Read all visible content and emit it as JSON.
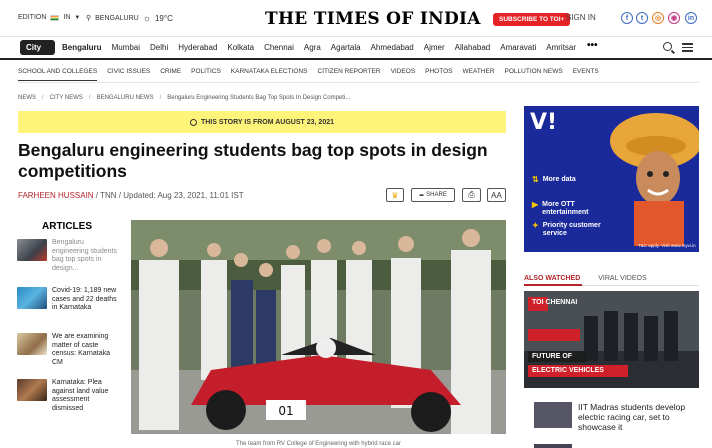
{
  "header": {
    "edition_label": "EDITION",
    "edition_value": "IN",
    "city": "BENGALURU",
    "temperature": "19°C",
    "logo": "THE TIMES OF INDIA",
    "subscribe": "SUBSCRIBE TO TOI+",
    "signin": "SIGN IN",
    "social": [
      "f",
      "t",
      "◎",
      "◉",
      "in"
    ]
  },
  "citynav": {
    "city_button": "City",
    "items": [
      "Bengaluru",
      "Mumbai",
      "Delhi",
      "Hyderabad",
      "Kolkata",
      "Chennai",
      "Agra",
      "Agartala",
      "Ahmedabad",
      "Ajmer",
      "Allahabad",
      "Amaravati",
      "Amritsar"
    ],
    "more": "•••"
  },
  "sections": [
    "SCHOOL AND COLLEGES",
    "CIVIC ISSUES",
    "CRIME",
    "POLITICS",
    "KARNATAKA ELECTIONS",
    "CITIZEN REPORTER",
    "VIDEOS",
    "PHOTOS",
    "WEATHER",
    "POLLUTION NEWS",
    "EVENTS"
  ],
  "breadcrumb": [
    "NEWS",
    "CITY NEWS",
    "BENGALURU NEWS",
    "Bengaluru Engineering Students Bag Top Spots In Design Competi..."
  ],
  "banner": "THIS STORY IS FROM AUGUST 23, 2021",
  "article": {
    "headline": "Bengaluru engineering students bag top spots in design competitions",
    "author": "FARHEEN HUSSAIN",
    "byline_rest": " / TNN / Updated: Aug 23, 2021, 11:01 IST",
    "share": "SHARE",
    "font_label": "AA",
    "caption": "The team from RV College of Engineering with hybrid race car"
  },
  "rail": {
    "title": "ARTICLES",
    "items": [
      {
        "text": "Bengaluru engineering students bag top spots in design...",
        "muted": true
      },
      {
        "text": "Covid-19: 1,189 new cases and 22 deaths in Karnataka",
        "muted": false
      },
      {
        "text": "We are examining matter of caste census: Karnataka CM",
        "muted": false
      },
      {
        "text": "Karnataka: Plea against land value assessment dismissed",
        "muted": false
      }
    ]
  },
  "ad": {
    "brand": "V!",
    "lines": [
      "More data",
      "More OTT entertainment",
      "Priority customer service"
    ],
    "tc": "T&C apply. Visit www.myvi.in"
  },
  "watch": {
    "tabs": [
      "ALSO WATCHED",
      "VIRAL VIDEOS"
    ],
    "video_label_channel": "TOI CHENNAI",
    "video_label_1": "FUTURE OF",
    "video_label_2": "ELECTRIC VEHICLES",
    "second_title": "IIT Madras students develop electric racing car, set to showcase it"
  }
}
